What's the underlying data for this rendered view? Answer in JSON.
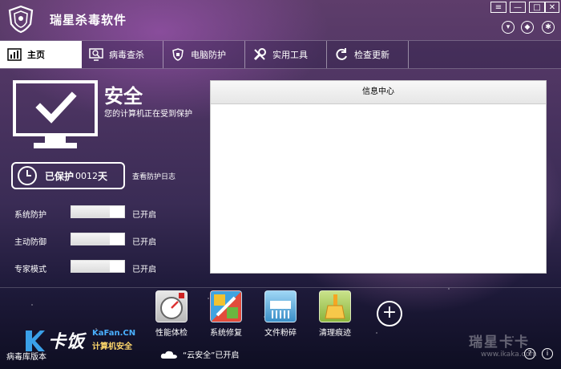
{
  "app": {
    "title": "瑞星杀毒软件"
  },
  "window_controls": {
    "menu": "≡",
    "minimize": "—",
    "maximize": "□",
    "close": "✕"
  },
  "tabs": [
    {
      "label": "主页",
      "icon": "bar-chart-icon",
      "active": true
    },
    {
      "label": "病毒查杀",
      "icon": "monitor-search-icon",
      "active": false
    },
    {
      "label": "电脑防护",
      "icon": "shield-icon",
      "active": false
    },
    {
      "label": "实用工具",
      "icon": "wrench-icon",
      "active": false
    },
    {
      "label": "检查更新",
      "icon": "refresh-icon",
      "active": false
    }
  ],
  "status": {
    "title": "安全",
    "description": "您的计算机正在受到保护",
    "protect_label": "已保护",
    "protect_days": "0012",
    "protect_unit": "天",
    "log_link": "查看防护日志"
  },
  "settings": [
    {
      "label": "系统防护",
      "state": "已开启"
    },
    {
      "label": "主动防御",
      "state": "已开启"
    },
    {
      "label": "专家模式",
      "state": "已开启"
    }
  ],
  "info_center": {
    "title": "信息中心"
  },
  "tools": [
    {
      "label": "性能体检",
      "icon": "gauge-icon"
    },
    {
      "label": "系统修复",
      "icon": "repair-icon"
    },
    {
      "label": "文件粉碎",
      "icon": "shredder-icon"
    },
    {
      "label": "清理痕迹",
      "icon": "broom-icon"
    }
  ],
  "add_tool": "+",
  "footer": {
    "left_text": "病毒库版本",
    "cloud_status": "“云安全”已开启",
    "kafan_title": "卡饭",
    "kafan_site": "KaFan.CN",
    "kafan_sub": "计算机安全",
    "watermark": "瑞星卡卡",
    "watermark_url": "www.ikaka.com",
    "help": "?",
    "info": "i"
  },
  "colors": {
    "accent_purple": "#4a3360",
    "panel_white": "#ffffff"
  }
}
